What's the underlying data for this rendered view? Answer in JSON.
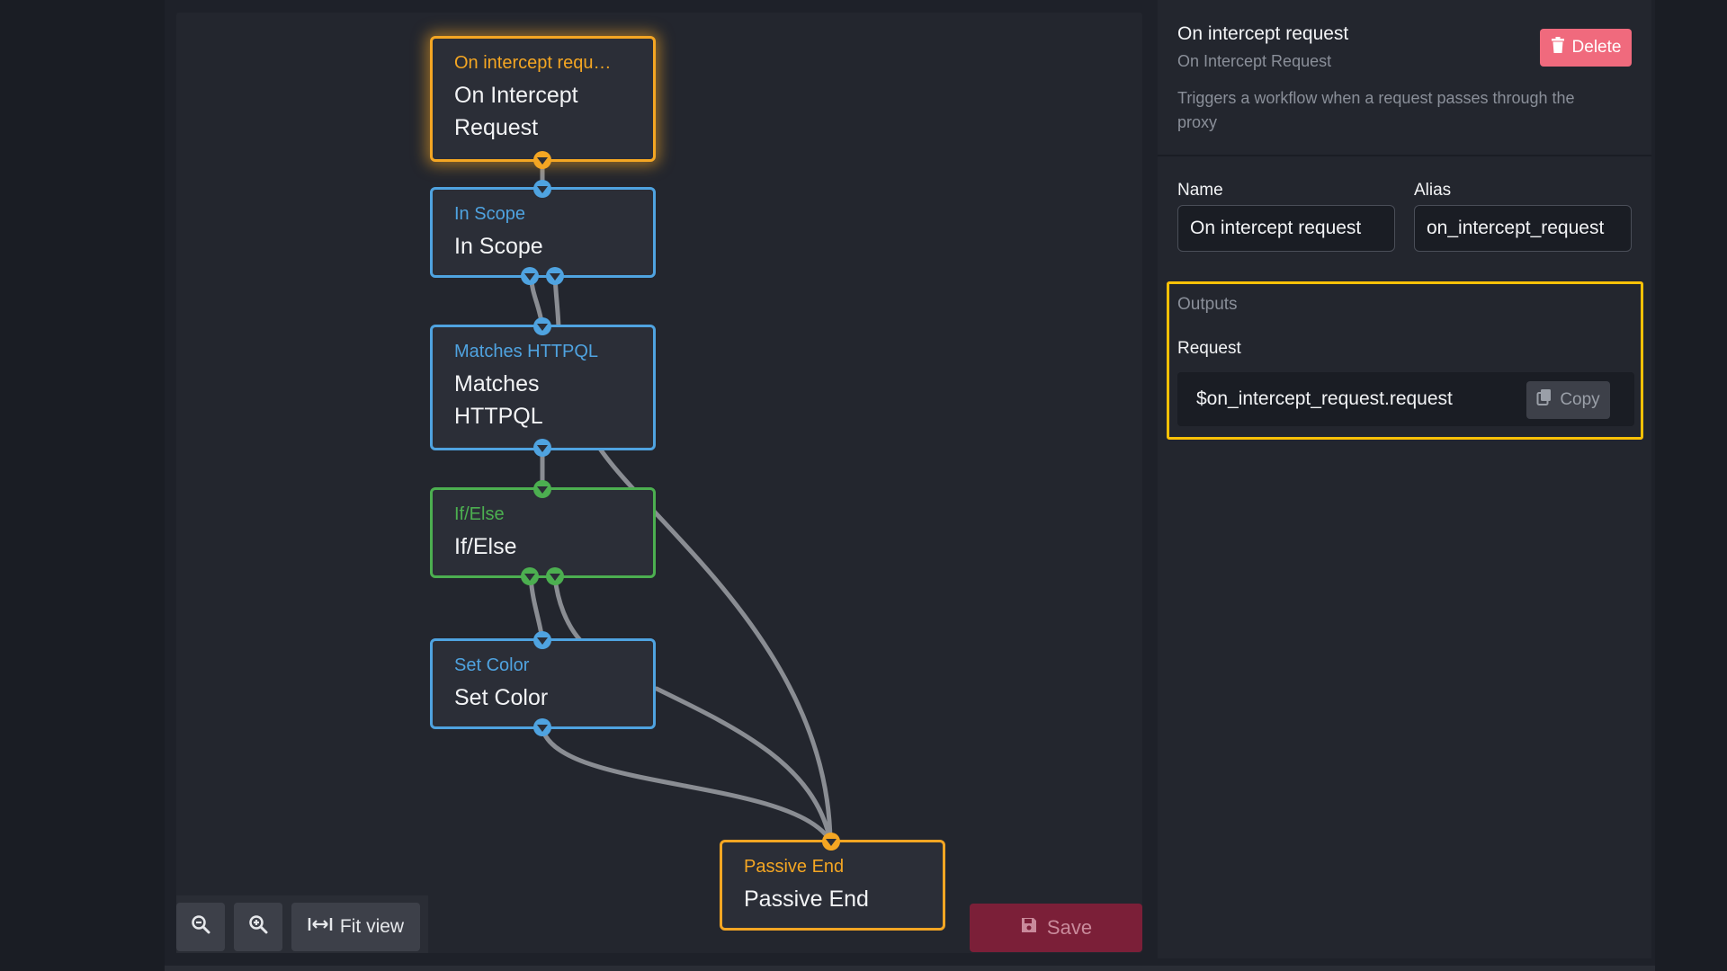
{
  "nodes": {
    "on_intercept": {
      "type": "On intercept requ…",
      "label": "On Intercept Request"
    },
    "in_scope": {
      "type": "In Scope",
      "label": "In Scope"
    },
    "matches_httpql": {
      "type": "Matches HTTPQL",
      "label": "Matches HTTPQL"
    },
    "if_else": {
      "type": "If/Else",
      "label": "If/Else"
    },
    "set_color": {
      "type": "Set Color",
      "label": "Set Color"
    },
    "passive_end": {
      "type": "Passive End",
      "label": "Passive End"
    }
  },
  "toolbar": {
    "zoom_out_icon": "zoom-out-icon",
    "zoom_in_icon": "zoom-in-icon",
    "fit_view_label": "Fit view",
    "save_label": "Save"
  },
  "panel": {
    "title": "On intercept request",
    "subtitle": "On Intercept Request",
    "description": "Triggers a workflow when a request passes through the proxy",
    "delete_label": "Delete",
    "name_label": "Name",
    "name_value": "On intercept request",
    "alias_label": "Alias",
    "alias_value": "on_intercept_request",
    "outputs_title": "Outputs",
    "output_label": "Request",
    "output_value": "$on_intercept_request.request",
    "copy_label": "Copy"
  },
  "colors": {
    "accent_orange": "#f4a623",
    "accent_blue": "#4fa3e0",
    "accent_green": "#4caf50",
    "highlight": "#ffc107",
    "delete": "#f06a7d",
    "save": "#7b1f38"
  }
}
